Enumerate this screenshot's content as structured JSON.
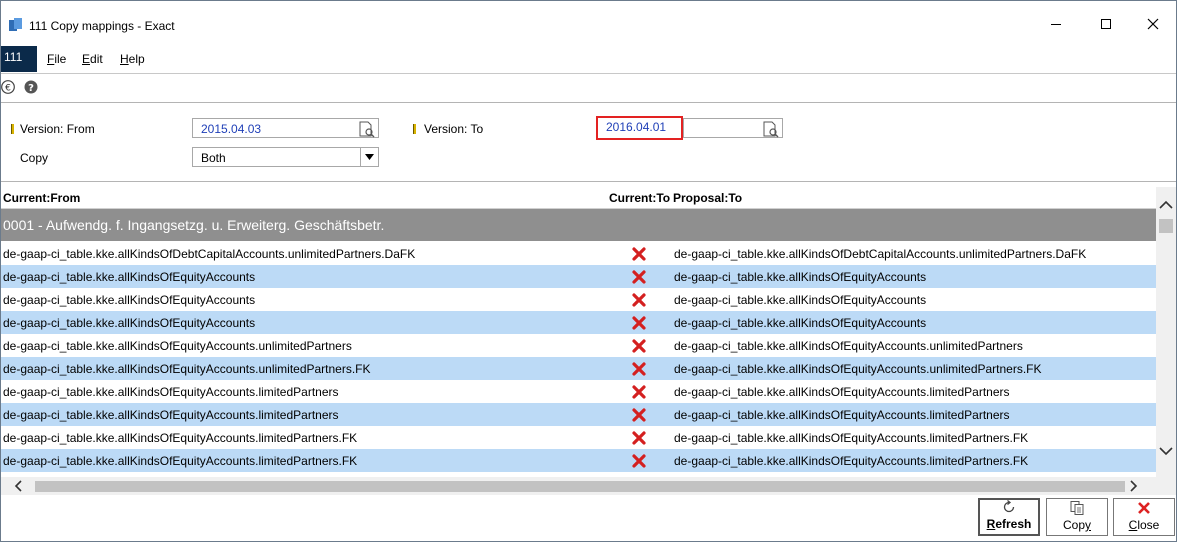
{
  "window": {
    "title": "111 Copy mappings - Exact"
  },
  "menu": {
    "company": "111",
    "items": [
      {
        "pre": "",
        "key": "F",
        "post": "ile"
      },
      {
        "pre": "",
        "key": "E",
        "post": "dit"
      },
      {
        "pre": "",
        "key": "H",
        "post": "elp"
      }
    ]
  },
  "toolbar": {
    "icons": [
      "euro-icon",
      "help-icon"
    ]
  },
  "criteria": {
    "version_from_label": "Version: From",
    "version_from_value": "2015.04.03",
    "version_to_label": "Version: To",
    "version_to_value": "2016.04.01",
    "copy_label": "Copy",
    "copy_value": "Both"
  },
  "grid": {
    "columns": [
      "Current:From",
      "Current:To",
      "Proposal:To"
    ],
    "group": "0001 - Aufwendg. f. Ingangsetzg. u. Erweiterg. Geschäftsbetr.",
    "rows": [
      {
        "from": "de-gaap-ci_table.kke.allKindsOfDebtCapitalAccounts.unlimitedPartners.DaFK",
        "to_icon": "red-x-icon",
        "proposal": "de-gaap-ci_table.kke.allKindsOfDebtCapitalAccounts.unlimitedPartners.DaFK"
      },
      {
        "from": "de-gaap-ci_table.kke.allKindsOfEquityAccounts",
        "to_icon": "red-x-icon",
        "proposal": "de-gaap-ci_table.kke.allKindsOfEquityAccounts"
      },
      {
        "from": "de-gaap-ci_table.kke.allKindsOfEquityAccounts",
        "to_icon": "red-x-icon",
        "proposal": "de-gaap-ci_table.kke.allKindsOfEquityAccounts"
      },
      {
        "from": "de-gaap-ci_table.kke.allKindsOfEquityAccounts",
        "to_icon": "red-x-icon",
        "proposal": "de-gaap-ci_table.kke.allKindsOfEquityAccounts"
      },
      {
        "from": "de-gaap-ci_table.kke.allKindsOfEquityAccounts.unlimitedPartners",
        "to_icon": "red-x-icon",
        "proposal": "de-gaap-ci_table.kke.allKindsOfEquityAccounts.unlimitedPartners"
      },
      {
        "from": "de-gaap-ci_table.kke.allKindsOfEquityAccounts.unlimitedPartners.FK",
        "to_icon": "red-x-icon",
        "proposal": "de-gaap-ci_table.kke.allKindsOfEquityAccounts.unlimitedPartners.FK"
      },
      {
        "from": "de-gaap-ci_table.kke.allKindsOfEquityAccounts.limitedPartners",
        "to_icon": "red-x-icon",
        "proposal": "de-gaap-ci_table.kke.allKindsOfEquityAccounts.limitedPartners"
      },
      {
        "from": "de-gaap-ci_table.kke.allKindsOfEquityAccounts.limitedPartners",
        "to_icon": "red-x-icon",
        "proposal": "de-gaap-ci_table.kke.allKindsOfEquityAccounts.limitedPartners"
      },
      {
        "from": "de-gaap-ci_table.kke.allKindsOfEquityAccounts.limitedPartners.FK",
        "to_icon": "red-x-icon",
        "proposal": "de-gaap-ci_table.kke.allKindsOfEquityAccounts.limitedPartners.FK"
      },
      {
        "from": "de-gaap-ci_table.kke.allKindsOfEquityAccounts.limitedPartners.FK",
        "to_icon": "red-x-icon",
        "proposal": "de-gaap-ci_table.kke.allKindsOfEquityAccounts.limitedPartners.FK"
      }
    ]
  },
  "buttons": {
    "refresh": {
      "key": "R",
      "rest": "efresh"
    },
    "copy": {
      "pre": "Cop",
      "key": "y",
      "rest": ""
    },
    "close": {
      "key": "C",
      "rest": "lose"
    }
  },
  "colors": {
    "row_alt": "#bcdaf6",
    "group_row": "#8f8f8f",
    "company_badge": "#0b2a4a",
    "highlight_border": "#e32222",
    "field_text": "#1f3fb7"
  }
}
